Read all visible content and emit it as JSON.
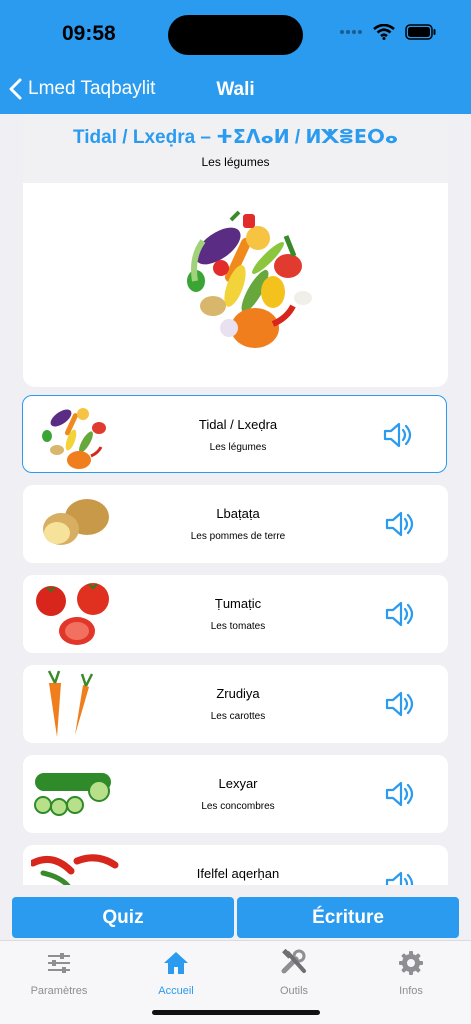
{
  "status": {
    "time": "09:58"
  },
  "nav": {
    "back_label": "Lmed Taqbaylit",
    "title": "Wali"
  },
  "hero": {
    "title": "Tidal / Lxeḍra – ⵜⵉⴷⴰⵍ / ⵍⵅⴻⴹⵔⴰ",
    "subtitle": "Les légumes"
  },
  "items": [
    {
      "title": "Tidal / Lxeḍra",
      "subtitle": "Les légumes",
      "icon": "vegetables-image"
    },
    {
      "title": "Lbaṭaṭa",
      "subtitle": "Les pommes de terre",
      "icon": "potatoes-image"
    },
    {
      "title": "Ṭumaṭic",
      "subtitle": "Les tomates",
      "icon": "tomatoes-image"
    },
    {
      "title": "Zrudiya",
      "subtitle": "Les carottes",
      "icon": "carrots-image"
    },
    {
      "title": "Lexyar",
      "subtitle": "Les concombres",
      "icon": "cucumbers-image"
    },
    {
      "title": "Ifelfel aqerḥan",
      "subtitle": "",
      "icon": "chili-peppers-image"
    }
  ],
  "buttons": {
    "quiz": "Quiz",
    "ecriture": "Écriture"
  },
  "tabs": [
    {
      "label": "Paramètres",
      "icon": "sliders-icon"
    },
    {
      "label": "Accueil",
      "icon": "home-icon"
    },
    {
      "label": "Outils",
      "icon": "tools-icon"
    },
    {
      "label": "Infos",
      "icon": "gear-icon"
    }
  ],
  "colors": {
    "accent": "#2a9bef",
    "background": "#efeff4"
  }
}
